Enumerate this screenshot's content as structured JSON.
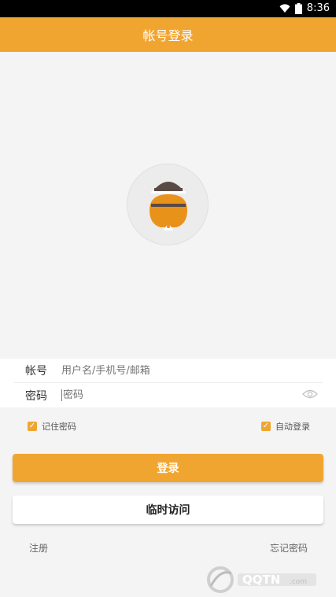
{
  "status_bar": {
    "time": "8:36",
    "icons": [
      "wifi-icon",
      "battery-icon"
    ]
  },
  "header": {
    "title": "帐号登录"
  },
  "form": {
    "account_label": "帐号",
    "account_placeholder": "用户名/手机号/邮箱",
    "password_label": "密码",
    "password_placeholder": "密码"
  },
  "options": {
    "remember_password": "记住密码",
    "auto_login": "自动登录"
  },
  "buttons": {
    "login": "登录",
    "guest": "临时访问"
  },
  "links": {
    "register": "注册",
    "forgot_password": "忘记密码"
  },
  "colors": {
    "accent": "#f1a531",
    "avatar_dark": "#5a4a44",
    "avatar_body": "#e8921a"
  }
}
